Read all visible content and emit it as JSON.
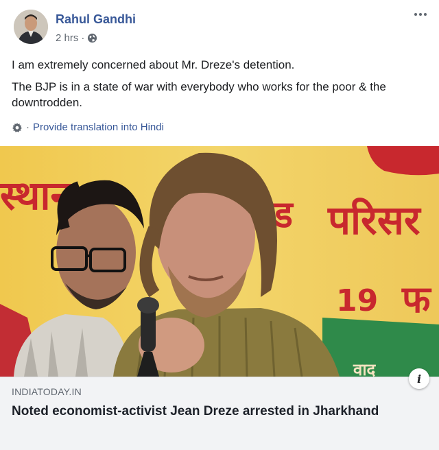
{
  "post": {
    "author": "Rahul Gandhi",
    "timestamp": "2 hrs",
    "meta_separator": "·",
    "privacy_icon": "globe-icon",
    "more_icon": "more-options-icon",
    "body": [
      "I am extremely concerned about Mr. Dreze's detention.",
      "The BJP is in a state of war with everybody who works for the poor & the downtrodden."
    ],
    "translate": {
      "icon": "gear-icon",
      "separator": "·",
      "label": "Provide translation into Hindi"
    }
  },
  "media": {
    "banner_texts": [
      "स्थान",
      "ड",
      "परिसर",
      "19",
      "फ",
      "वाद"
    ]
  },
  "link_preview": {
    "source": "INDIATODAY.IN",
    "headline": "Noted economist-activist Jean Dreze arrested in Jharkhand",
    "info_label": "i"
  },
  "colors": {
    "link": "#385898",
    "meta": "#606770",
    "preview_bg": "#f2f3f5",
    "banner_yellow": "#e9c64a",
    "banner_red": "#c8282e"
  }
}
